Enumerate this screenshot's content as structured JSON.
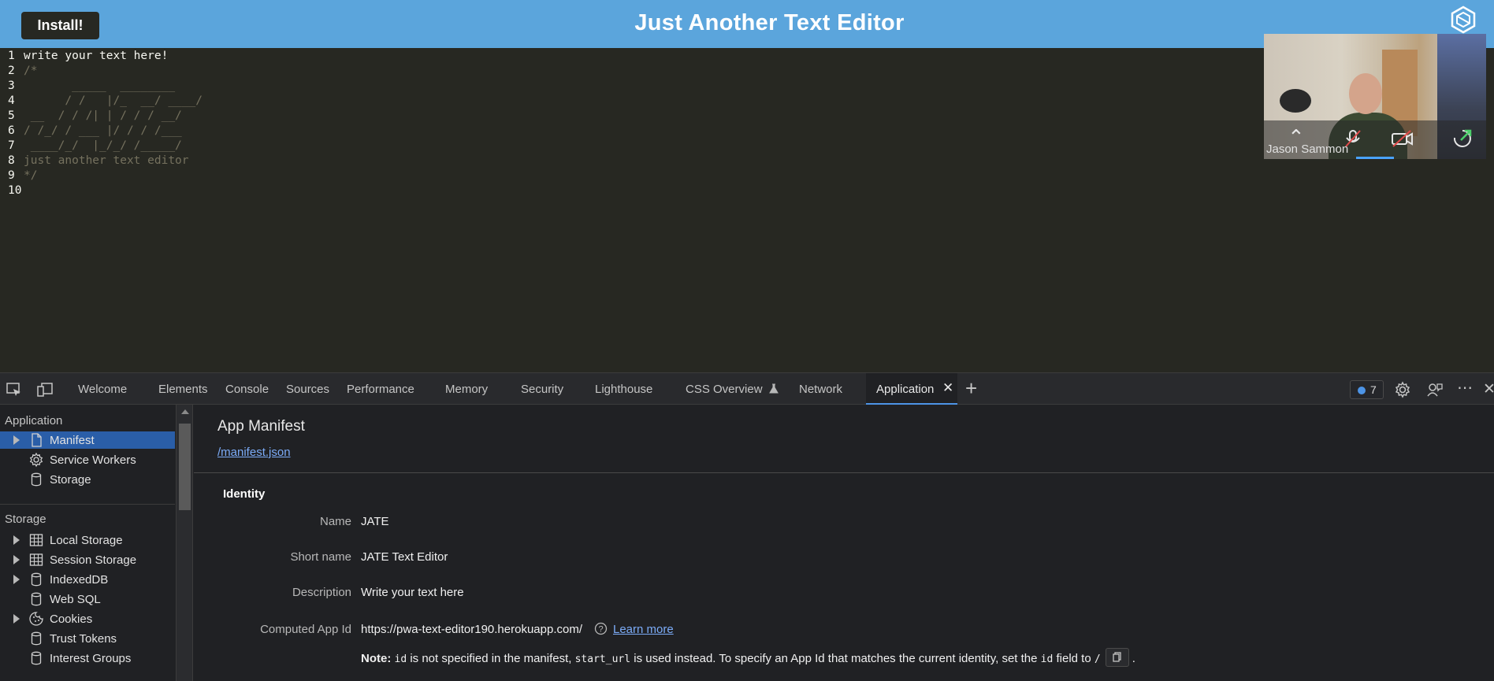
{
  "app": {
    "install_label": "Install!",
    "title": "Just Another Text Editor"
  },
  "editor": {
    "lines": [
      {
        "num": "1",
        "text": "write your text here!",
        "style": "plain"
      },
      {
        "num": "2",
        "text": "/*",
        "style": "comment"
      },
      {
        "num": "3",
        "text": "       _____  ________",
        "style": "comment"
      },
      {
        "num": "4",
        "text": "      / /   |/_  __/ ____/",
        "style": "comment"
      },
      {
        "num": "5",
        "text": " __  / / /| | / / / __/",
        "style": "comment"
      },
      {
        "num": "6",
        "text": "/ /_/ / ___ |/ / / /___",
        "style": "comment"
      },
      {
        "num": "7",
        "text": " ____/_/  |_/_/ /_____/",
        "style": "comment"
      },
      {
        "num": "8",
        "text": "just another text editor",
        "style": "comment"
      },
      {
        "num": "9",
        "text": "*/",
        "style": "comment"
      },
      {
        "num": "10",
        "text": "",
        "style": "plain"
      }
    ]
  },
  "video": {
    "participant_name": "Jason Sammon"
  },
  "devtools": {
    "tabs": [
      "Welcome",
      "Elements",
      "Console",
      "Sources",
      "Performance",
      "Memory",
      "Security",
      "Lighthouse",
      "CSS Overview",
      "Network",
      "Application"
    ],
    "active_tab": "Application",
    "issues_count": "7",
    "accent_color": "#4d94e6",
    "sidebar": {
      "application_heading": "Application",
      "application_items": [
        {
          "label": "Manifest",
          "icon": "file-icon",
          "expandable": true,
          "selected": true
        },
        {
          "label": "Service Workers",
          "icon": "gear-icon",
          "expandable": false
        },
        {
          "label": "Storage",
          "icon": "database-icon",
          "expandable": false
        }
      ],
      "storage_heading": "Storage",
      "storage_items": [
        {
          "label": "Local Storage",
          "icon": "grid-icon",
          "expandable": true
        },
        {
          "label": "Session Storage",
          "icon": "grid-icon",
          "expandable": true
        },
        {
          "label": "IndexedDB",
          "icon": "database-icon",
          "expandable": true
        },
        {
          "label": "Web SQL",
          "icon": "database-icon",
          "expandable": false
        },
        {
          "label": "Cookies",
          "icon": "cookie-icon",
          "expandable": true
        },
        {
          "label": "Trust Tokens",
          "icon": "database-icon",
          "expandable": false
        },
        {
          "label": "Interest Groups",
          "icon": "database-icon",
          "expandable": false
        }
      ]
    },
    "manifest": {
      "title": "App Manifest",
      "link": "/manifest.json",
      "section": "Identity",
      "fields": {
        "name_label": "Name",
        "name_value": "JATE",
        "short_name_label": "Short name",
        "short_name_value": "JATE Text Editor",
        "description_label": "Description",
        "description_value": "Write your text here",
        "app_id_label": "Computed App Id",
        "app_id_value": "https://pwa-text-editor190.herokuapp.com/"
      },
      "learn_more": "Learn more",
      "note": {
        "prefix": "Note:",
        "code_id": "id",
        "part1": "is not specified in the manifest,",
        "code_start_url": "start_url",
        "part2": "is used instead. To specify an App Id that matches the current identity, set the",
        "code_id2": "id",
        "part3": "field to",
        "code_slash": "/",
        "end": "."
      }
    }
  }
}
